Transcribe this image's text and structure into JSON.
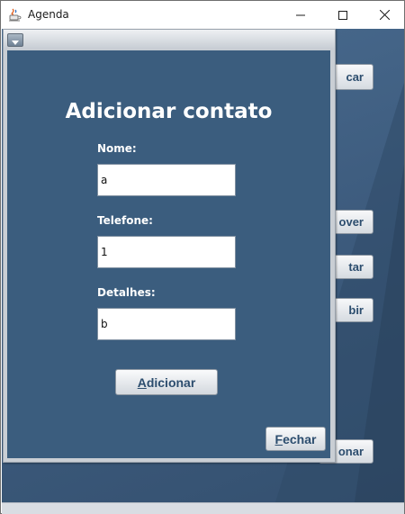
{
  "window": {
    "title": "Agenda",
    "controls": {
      "minimize": "minimize",
      "maximize": "maximize",
      "close": "close"
    }
  },
  "background": {
    "buttons": {
      "buscar": "car",
      "remover": "over",
      "editar": "tar",
      "exibir": "bir",
      "adicionar": "onar"
    }
  },
  "dialog": {
    "heading": "Adicionar contato",
    "fields": {
      "nome": {
        "label": "Nome:",
        "value": "a"
      },
      "telefone": {
        "label": "Telefone:",
        "value": "1"
      },
      "detalhes": {
        "label": "Detalhes:",
        "value": "b"
      }
    },
    "buttons": {
      "adicionar": {
        "mnemonic": "A",
        "rest": "dicionar"
      },
      "fechar": {
        "mnemonic": "F",
        "rest": "echar"
      }
    }
  },
  "colors": {
    "dialog_body": "#3b5d7e",
    "button_text": "#2c4d6e",
    "client_bg": "#4a6c90"
  },
  "icons": [
    "java-cup-icon",
    "minimize-icon",
    "maximize-icon",
    "close-icon",
    "dropdown-arrow-icon"
  ]
}
